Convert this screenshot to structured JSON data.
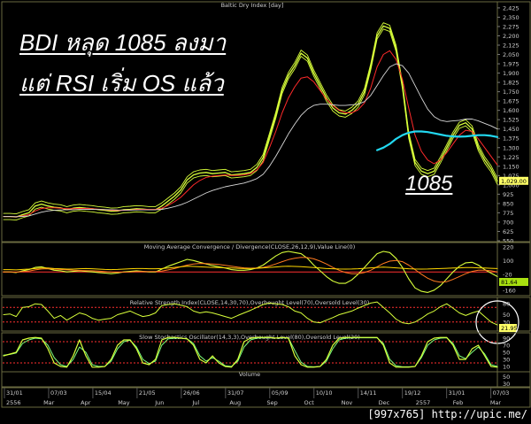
{
  "annotations": {
    "line1": "BDI หลุด 1085 ลงมา",
    "line2": "แต่ RSI เริ่ม OS แล้ว",
    "level": "1085"
  },
  "credit": "[997x765] http://upic.me/",
  "colors": {
    "background": "#000000",
    "bdi_line": "#d8ff3a",
    "ma_red": "#ff2a2a",
    "ma_white": "#d8d8d8",
    "ma_cyan": "#22d8f0",
    "macd": "#ffd700",
    "rsi": "#d8ff3a",
    "stoch_k": "#d8ff3a",
    "stoch_d": "#7cff7c",
    "guide_red": "#ff3030",
    "value_box": "#ffff66",
    "value_box2": "#a8e010"
  },
  "chart_data": [
    {
      "type": "line",
      "title": "Baltic Dry Index [day]",
      "x": [
        "31/01",
        "07/03",
        "15/04",
        "21/05",
        "26/06",
        "31/07",
        "05/09",
        "10/10",
        "14/11",
        "19/12",
        "31/01",
        "07/03"
      ],
      "months": [
        "2556",
        "Mar",
        "Apr",
        "May",
        "Jun",
        "Jul",
        "Aug",
        "Sep",
        "Oct",
        "Nov",
        "Dec",
        "2557",
        "Feb",
        "Mar"
      ],
      "yticks": [
        2425,
        2350,
        2275,
        2200,
        2125,
        2050,
        1975,
        1900,
        1825,
        1750,
        1675,
        1600,
        1525,
        1450,
        1375,
        1300,
        1225,
        1150,
        1075,
        1000,
        925,
        850,
        775,
        700,
        625,
        550
      ],
      "ylabels": [
        "2,425",
        "2,350",
        "2,275",
        "2,200",
        "2,125",
        "2,050",
        "1,975",
        "1,900",
        "1,825",
        "1,750",
        "1,675",
        "1,600",
        "1,525",
        "1,450",
        "1,375",
        "1,300",
        "1,225",
        "1,150",
        "1,075",
        "1,000",
        "925",
        "850",
        "775",
        "700",
        "625",
        "550"
      ],
      "ylim": [
        550,
        2460
      ],
      "last_value": "1,029.00",
      "series": [
        {
          "values": [
            745,
            745,
            742,
            760,
            775,
            830,
            845,
            830,
            820,
            815,
            800,
            812,
            818,
            812,
            808,
            800,
            795,
            788,
            790,
            800,
            803,
            808,
            805,
            800,
            800,
            830,
            870,
            910,
            960,
            1040,
            1080,
            1095,
            1100,
            1090,
            1095,
            1100,
            1080,
            1085,
            1090,
            1100,
            1140,
            1220,
            1390,
            1560,
            1760,
            1880,
            1960,
            2060,
            2020,
            1900,
            1800,
            1700,
            1620,
            1580,
            1570,
            1600,
            1650,
            1750,
            1950,
            2200,
            2280,
            2260,
            2100,
            1800,
            1400,
            1180,
            1110,
            1090,
            1110,
            1200,
            1300,
            1400,
            1480,
            1500,
            1450,
            1300,
            1200,
            1130,
            1029
          ]
        },
        {
          "values": [
            745,
            745,
            743,
            750,
            760,
            790,
            810,
            815,
            815,
            812,
            808,
            808,
            810,
            810,
            808,
            804,
            800,
            796,
            794,
            796,
            798,
            802,
            803,
            802,
            802,
            812,
            835,
            865,
            900,
            950,
            1000,
            1035,
            1060,
            1070,
            1075,
            1080,
            1075,
            1075,
            1080,
            1090,
            1120,
            1180,
            1300,
            1430,
            1580,
            1700,
            1790,
            1860,
            1870,
            1830,
            1760,
            1690,
            1640,
            1600,
            1580,
            1580,
            1605,
            1660,
            1780,
            1950,
            2050,
            2080,
            2010,
            1850,
            1620,
            1400,
            1270,
            1200,
            1170,
            1200,
            1260,
            1330,
            1400,
            1440,
            1430,
            1370,
            1300,
            1230,
            1160
          ]
        },
        {
          "values": [
            745,
            745,
            744,
            746,
            750,
            765,
            780,
            790,
            795,
            798,
            800,
            800,
            802,
            803,
            803,
            802,
            801,
            800,
            798,
            797,
            797,
            798,
            799,
            799,
            800,
            803,
            812,
            825,
            840,
            860,
            885,
            910,
            935,
            955,
            970,
            985,
            995,
            1005,
            1015,
            1030,
            1050,
            1085,
            1150,
            1230,
            1320,
            1410,
            1490,
            1560,
            1610,
            1640,
            1650,
            1650,
            1645,
            1640,
            1640,
            1645,
            1650,
            1670,
            1720,
            1800,
            1880,
            1950,
            1975,
            1960,
            1900,
            1800,
            1700,
            1610,
            1550,
            1520,
            1510,
            1515,
            1520,
            1530,
            1530,
            1515,
            1495,
            1475,
            1450
          ]
        },
        {
          "values": [
            null,
            null,
            null,
            null,
            null,
            null,
            null,
            null,
            null,
            null,
            null,
            null,
            null,
            null,
            null,
            null,
            null,
            null,
            null,
            null,
            null,
            null,
            null,
            null,
            null,
            null,
            null,
            null,
            null,
            null,
            null,
            null,
            null,
            null,
            null,
            null,
            null,
            null,
            null,
            null,
            null,
            null,
            null,
            null,
            null,
            null,
            null,
            null,
            null,
            null,
            null,
            null,
            null,
            null,
            null,
            null,
            null,
            null,
            null,
            1280,
            1300,
            1330,
            1370,
            1400,
            1420,
            1430,
            1430,
            1425,
            1415,
            1405,
            1395,
            1390,
            1388,
            1390,
            1395,
            1400,
            1400,
            1395,
            1385
          ]
        }
      ]
    },
    {
      "type": "line",
      "title": "Moving Average Convergence / Divergence(CLOSE,26,12,9),Value Line(0)",
      "yticks": [
        220,
        100,
        -20,
        -160
      ],
      "yticks_labels": [
        "220",
        "100",
        "-20",
        "-160"
      ],
      "ylim": [
        -200,
        250
      ],
      "last_value": "81.64",
      "series": [
        {
          "values": [
            0,
            0,
            -5,
            10,
            20,
            40,
            45,
            30,
            15,
            10,
            0,
            5,
            10,
            5,
            0,
            -5,
            -10,
            -15,
            -10,
            0,
            5,
            10,
            5,
            0,
            0,
            25,
            50,
            70,
            90,
            110,
            100,
            85,
            70,
            55,
            45,
            35,
            20,
            15,
            15,
            20,
            35,
            60,
            100,
            140,
            170,
            180,
            170,
            160,
            120,
            60,
            10,
            -40,
            -80,
            -100,
            -100,
            -70,
            -20,
            40,
            100,
            160,
            180,
            170,
            120,
            40,
            -60,
            -140,
            -170,
            -180,
            -160,
            -120,
            -60,
            0,
            50,
            80,
            85,
            60,
            20,
            -10,
            -40
          ]
        },
        {
          "values": [
            0,
            0,
            -2,
            3,
            8,
            18,
            26,
            28,
            25,
            22,
            18,
            15,
            13,
            12,
            10,
            7,
            3,
            -1,
            -3,
            -2,
            0,
            3,
            4,
            3,
            3,
            8,
            18,
            30,
            45,
            60,
            70,
            75,
            74,
            70,
            65,
            58,
            50,
            42,
            36,
            33,
            34,
            40,
            52,
            70,
            90,
            108,
            120,
            128,
            126,
            115,
            95,
            70,
            40,
            15,
            -5,
            -15,
            -15,
            -5,
            15,
            45,
            75,
            95,
            100,
            90,
            60,
            20,
            -20,
            -55,
            -80,
            -90,
            -85,
            -65,
            -40,
            -15,
            5,
            15,
            15,
            10,
            0
          ]
        },
        {
          "values": [
            20,
            20,
            18,
            22,
            25,
            30,
            35,
            35,
            30,
            28,
            25,
            25,
            28,
            30,
            28,
            25,
            22,
            20,
            22,
            25,
            28,
            30,
            30,
            28,
            28,
            30,
            35,
            40,
            45,
            50,
            48,
            45,
            42,
            40,
            38,
            36,
            34,
            32,
            30,
            30,
            32,
            36,
            40,
            44,
            48,
            50,
            48,
            46,
            42,
            38,
            34,
            30,
            28,
            26,
            25,
            26,
            28,
            32,
            36,
            40,
            42,
            40,
            36,
            32,
            28,
            26,
            25,
            26,
            28,
            30,
            32,
            34,
            36,
            38,
            38,
            36,
            34,
            32,
            30
          ]
        }
      ]
    },
    {
      "type": "line",
      "title": "Relative Strength Index(CLOSE,14,30,70),Overbought Level(70),Oversold Level(30)",
      "yticks": [
        80,
        50,
        30
      ],
      "yticks_labels": [
        "80",
        "50",
        "30"
      ],
      "ylim": [
        10,
        95
      ],
      "overbought": 70,
      "oversold": 30,
      "last_value": "21.95",
      "series": [
        {
          "values": [
            50,
            52,
            45,
            70,
            72,
            80,
            78,
            60,
            40,
            48,
            35,
            45,
            55,
            50,
            40,
            35,
            38,
            40,
            50,
            55,
            60,
            52,
            45,
            48,
            55,
            75,
            78,
            80,
            76,
            72,
            60,
            55,
            58,
            55,
            50,
            45,
            40,
            48,
            55,
            62,
            70,
            78,
            82,
            80,
            78,
            72,
            60,
            55,
            40,
            30,
            28,
            35,
            42,
            50,
            55,
            60,
            68,
            75,
            82,
            85,
            70,
            55,
            38,
            28,
            25,
            30,
            40,
            52,
            60,
            72,
            80,
            68,
            55,
            48,
            55,
            60,
            45,
            30,
            22
          ]
        }
      ]
    },
    {
      "type": "line",
      "title": "Slow Stochastics Oscillator(14,3,3),Overbought Level(80),Oversold Level(20)",
      "yticks": [
        90,
        70,
        50,
        30,
        10
      ],
      "yticks_labels": [
        "90",
        "70",
        "50",
        "30",
        "10"
      ],
      "ylim": [
        0,
        100
      ],
      "overbought": 80,
      "oversold": 20,
      "series": [
        {
          "values": [
            40,
            45,
            50,
            85,
            90,
            92,
            90,
            60,
            20,
            10,
            8,
            40,
            85,
            40,
            8,
            8,
            10,
            30,
            70,
            85,
            85,
            60,
            20,
            15,
            30,
            85,
            92,
            92,
            90,
            88,
            70,
            30,
            20,
            40,
            20,
            10,
            8,
            30,
            80,
            90,
            92,
            92,
            92,
            90,
            92,
            90,
            40,
            15,
            8,
            8,
            10,
            30,
            70,
            90,
            92,
            92,
            92,
            92,
            92,
            92,
            70,
            20,
            8,
            8,
            8,
            10,
            40,
            80,
            90,
            92,
            92,
            70,
            30,
            30,
            60,
            70,
            40,
            10,
            8
          ]
        },
        {
          "values": [
            42,
            44,
            48,
            75,
            85,
            90,
            88,
            70,
            35,
            15,
            10,
            30,
            65,
            50,
            15,
            10,
            10,
            25,
            60,
            80,
            84,
            65,
            30,
            18,
            25,
            70,
            88,
            90,
            90,
            88,
            75,
            40,
            25,
            35,
            25,
            12,
            10,
            25,
            65,
            85,
            90,
            91,
            91,
            90,
            91,
            90,
            55,
            22,
            10,
            9,
            10,
            25,
            60,
            85,
            90,
            91,
            91,
            91,
            91,
            91,
            75,
            30,
            12,
            9,
            9,
            10,
            35,
            70,
            85,
            90,
            91,
            75,
            40,
            32,
            50,
            65,
            45,
            15,
            10
          ]
        }
      ]
    },
    {
      "type": "bar",
      "title": "Volume",
      "yticks": [],
      "series": []
    }
  ]
}
